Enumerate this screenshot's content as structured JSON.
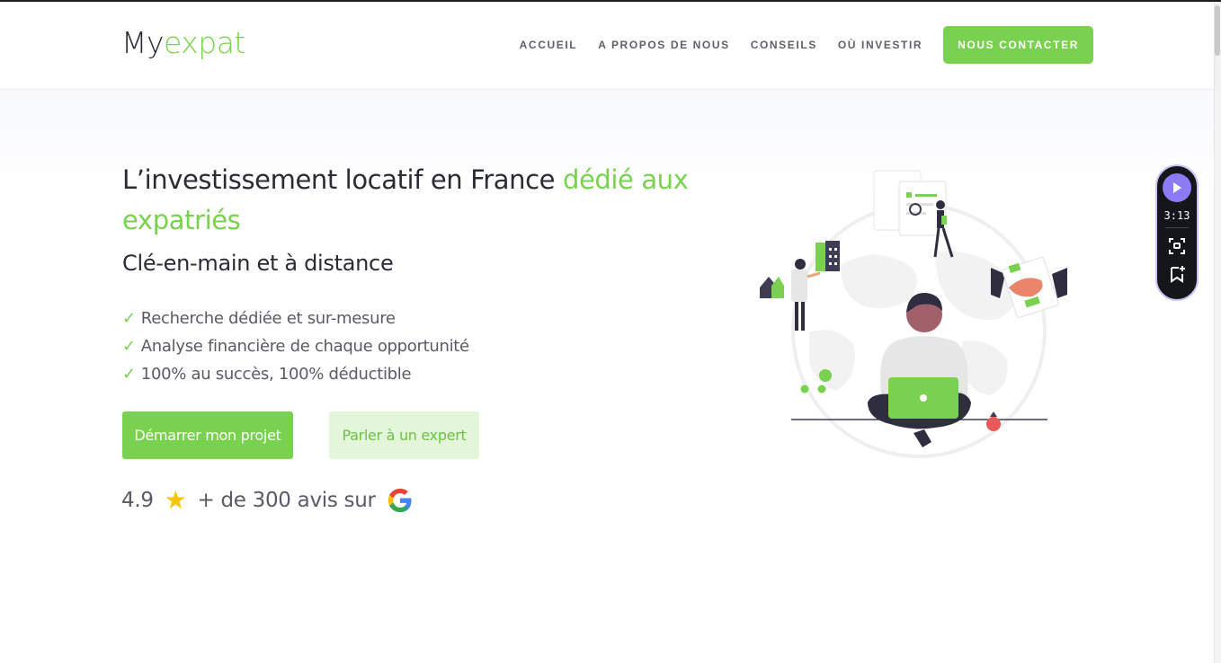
{
  "header": {
    "logo_my": "My",
    "logo_expat": "expat",
    "nav": [
      "ACCUEIL",
      "A PROPOS DE NOUS",
      "CONSEILS",
      "OÙ INVESTIR"
    ],
    "cta": "NOUS CONTACTER"
  },
  "hero": {
    "title_main": "L’investissement locatif en France ",
    "title_accent": "dédié aux expatriés",
    "subtitle": "Clé-en-main et à distance",
    "features": [
      "Recherche dédiée et sur-mesure",
      "Analyse financière de chaque opportunité",
      "100% au succès, 100% déductible"
    ],
    "check_symbol": "✓",
    "primary_button": "Démarrer mon projet",
    "secondary_button": "Parler à un expert"
  },
  "rating": {
    "score": "4.9",
    "star": "★",
    "text": "+ de 300 avis sur",
    "icon": "google-icon"
  },
  "video_widget": {
    "time": "3:13",
    "icons": [
      "play-icon",
      "screenshot-icon",
      "bookmark-add-icon"
    ]
  },
  "colors": {
    "accent": "#7ad04f",
    "accent_light": "#e4f6da",
    "text_dark": "#2b2b33",
    "text_muted": "#5a5a66",
    "widget_purple": "#8b7cf6"
  }
}
